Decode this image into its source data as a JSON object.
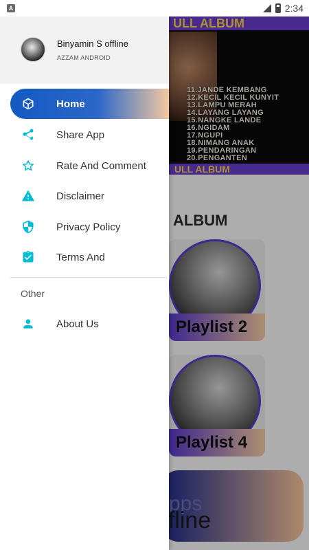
{
  "status_bar": {
    "left_badge": "A",
    "time": "2:34"
  },
  "background": {
    "banner_top": "ULL ALBUM",
    "banner_bottom": "ULL ALBUM",
    "tracklist": [
      "11.JANDE KEMBANG",
      "12.KECIL KECIL KUNYIT",
      "13.LAMPU MERAH",
      "14.LAYANG LAYANG",
      "15.NANGKE LANDE",
      "16.NGIDAM",
      "17.NGUPI",
      "18.NIMANG ANAK",
      "19.PENDARINGAN",
      "20.PENGANTEN"
    ],
    "section_title": "ALBUM",
    "cards": [
      {
        "label": "Playlist 2"
      },
      {
        "label": "Playlist 4"
      }
    ],
    "promo_line_1": "pps",
    "promo_line_2": "ffline"
  },
  "drawer": {
    "profile": {
      "name": "Binyamin S offline",
      "subtitle": "AZZAM ANDROID"
    },
    "items": [
      {
        "label": "Home",
        "icon": "cube-icon",
        "active": true
      },
      {
        "label": "Share App",
        "icon": "share-icon"
      },
      {
        "label": "Rate And Comment",
        "icon": "star-icon"
      },
      {
        "label": "Disclaimer",
        "icon": "warning-icon"
      },
      {
        "label": "Privacy Policy",
        "icon": "shield-icon"
      },
      {
        "label": "Terms And",
        "icon": "clipboard-check-icon"
      }
    ],
    "other_heading": "Other",
    "other_items": [
      {
        "label": "About Us",
        "icon": "person-icon"
      }
    ]
  },
  "colors": {
    "accent": "#00bcd4",
    "active_gradient_start": "#1359c2",
    "active_gradient_end": "#f4c9a0"
  }
}
